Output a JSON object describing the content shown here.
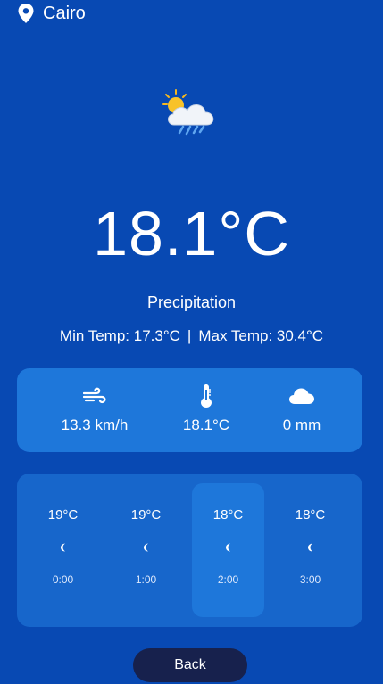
{
  "location": {
    "city": "Cairo",
    "icon": "location-pin-icon"
  },
  "current": {
    "icon": "sun-cloud-rain-icon",
    "temperature": "18.1°C",
    "condition": "Precipitation",
    "min_temp": "Min Temp: 17.3°C",
    "separator": "|",
    "max_temp": "Max Temp: 30.4°C"
  },
  "stats": [
    {
      "name": "wind",
      "icon": "wind-icon",
      "value": "13.3 km/h"
    },
    {
      "name": "temperature",
      "icon": "thermometer-icon",
      "value": "18.1°C"
    },
    {
      "name": "precipitation",
      "icon": "cloud-icon",
      "value": "0 mm"
    }
  ],
  "hourly": [
    {
      "temp": "19°C",
      "icon": "crescent-moon-icon",
      "time": "0:00",
      "selected": false
    },
    {
      "temp": "19°C",
      "icon": "crescent-moon-icon",
      "time": "1:00",
      "selected": false
    },
    {
      "temp": "18°C",
      "icon": "crescent-moon-icon",
      "time": "2:00",
      "selected": true
    },
    {
      "temp": "18°C",
      "icon": "crescent-moon-icon",
      "time": "3:00",
      "selected": false
    }
  ],
  "back_button": {
    "label": "Back"
  },
  "colors": {
    "background": "#0849B3",
    "stats_card": "#1E77DA",
    "hourly_card": "#1766CB",
    "selected_hour": "#1E77DA",
    "back_button": "#17214D",
    "text": "#FFFFFF"
  }
}
